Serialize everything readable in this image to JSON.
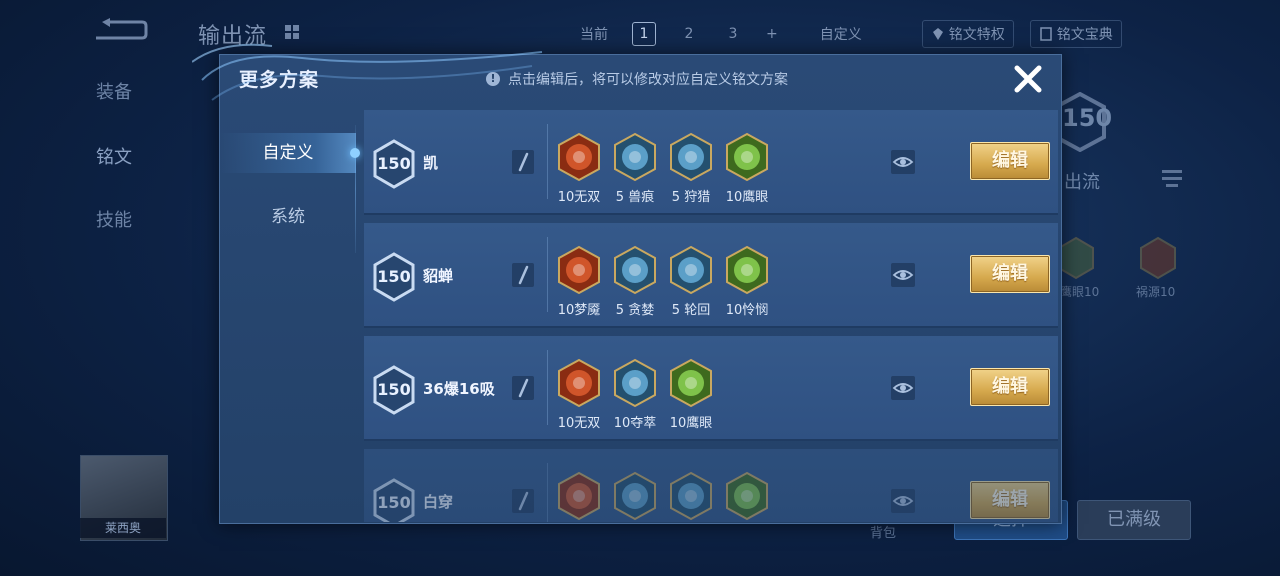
{
  "background": {
    "header_title": "输出流",
    "tab_current_label": "当前",
    "tab_numbers": [
      "1",
      "2",
      "3"
    ],
    "tab_add": "+",
    "tab_custom": "自定义",
    "btn_rune_perk": "铭文特权",
    "btn_rune_book": "铭文宝典",
    "side_equipment": "装备",
    "side_rune": "铭文",
    "side_skill": "技能",
    "hero_name": "莱西奥",
    "right_level": "150",
    "right_label": "出流",
    "right_rune_labels": [
      "鹰眼10",
      "祸源10"
    ],
    "backpack": "背包",
    "btn_primary": "选择",
    "btn_maxed": "已满级"
  },
  "modal": {
    "title": "更多方案",
    "tip": "点击编辑后，将可以修改对应自定义铭文方案",
    "tip_icon": "!",
    "close_icon": "close-x",
    "tabs": [
      {
        "label": "自定义",
        "active": true
      },
      {
        "label": "系统",
        "active": false
      }
    ],
    "edit_label": "编辑",
    "rows": [
      {
        "level": "150",
        "name": "凯",
        "runes": [
          {
            "icon": "red",
            "label": "10无双"
          },
          {
            "icon": "blue",
            "label": "5 兽痕"
          },
          {
            "icon": "blue",
            "label": "5 狩猎"
          },
          {
            "icon": "green",
            "label": "10鹰眼"
          }
        ]
      },
      {
        "level": "150",
        "name": "貂蝉",
        "runes": [
          {
            "icon": "red",
            "label": "10梦魇"
          },
          {
            "icon": "blue",
            "label": "5 贪婪"
          },
          {
            "icon": "blue",
            "label": "5 轮回"
          },
          {
            "icon": "green",
            "label": "10怜悯"
          }
        ]
      },
      {
        "level": "150",
        "name": "36爆16吸",
        "runes": [
          {
            "icon": "red",
            "label": "10无双"
          },
          {
            "icon": "blue",
            "label": "10夺萃"
          },
          {
            "icon": "green",
            "label": "10鹰眼"
          }
        ]
      },
      {
        "level": "150",
        "name": "白穿",
        "runes": [
          {
            "icon": "red",
            "label": ""
          },
          {
            "icon": "blue",
            "label": ""
          },
          {
            "icon": "blue",
            "label": ""
          },
          {
            "icon": "green",
            "label": ""
          }
        ]
      }
    ]
  },
  "colors": {
    "rune_red": "#d0552a",
    "rune_blue": "#5b9fc8",
    "rune_green": "#7fc24a",
    "gold": "#d6a94d"
  }
}
